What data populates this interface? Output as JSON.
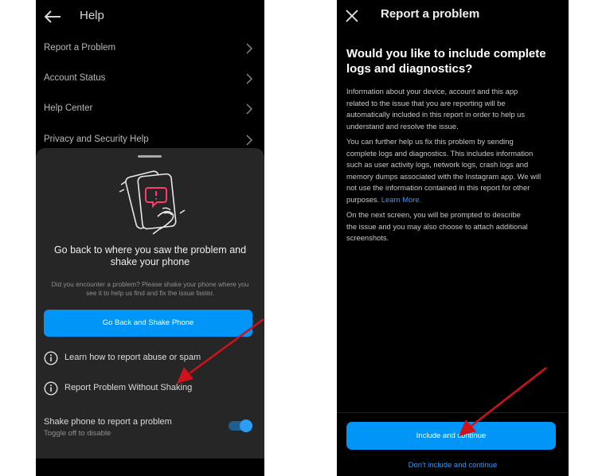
{
  "left_screen": {
    "header": {
      "title": "Help"
    },
    "menu": [
      {
        "label": "Report a Problem"
      },
      {
        "label": "Account Status"
      },
      {
        "label": "Help Center"
      },
      {
        "label": "Privacy and Security Help"
      }
    ],
    "sheet": {
      "title_lines": [
        "Go back to where you saw the problem and",
        "shake your phone"
      ],
      "description_lines": [
        "Did you encounter a problem? Please shake your phone where you",
        "see it to help us find and fix the issue faster."
      ],
      "primary_button": "Go Back and Shake Phone",
      "options": [
        {
          "label": "Learn how to report abuse or spam",
          "icon": "info-icon"
        },
        {
          "label": "Report Problem Without Shaking",
          "icon": "info-icon"
        }
      ],
      "toggle": {
        "label": "Shake phone to report a problem",
        "sublabel": "Toggle off to disable",
        "on": true
      }
    }
  },
  "right_screen": {
    "header": {
      "title": "Report a problem"
    },
    "heading_lines": [
      "Would you like to include complete",
      "logs and diagnostics?"
    ],
    "paragraph1_lines": [
      "Information about your device, account and this app",
      "related to the issue that you are reporting will be",
      "automatically included in this report in order to help us",
      "understand and resolve the issue."
    ],
    "paragraph2_lines": [
      "You can further help us fix this problem by sending",
      "complete logs and diagnostics. This includes information",
      "such as user activity logs, network logs, crash logs and",
      "memory dumps associated with the Instagram app. We will",
      "not use the information contained in this report for other",
      "purposes."
    ],
    "learn_more": "Learn More.",
    "paragraph3_lines": [
      "On the next screen, you will be prompted to describe",
      "the issue and you may also choose to attach additional",
      "screenshots."
    ],
    "primary_button": "Include and continue",
    "secondary_button": "Don't include and continue"
  },
  "colors": {
    "accent": "#0095f6",
    "link": "#3797f0",
    "annotation_arrow": "#d0121b",
    "sheet_bg": "#262626"
  }
}
